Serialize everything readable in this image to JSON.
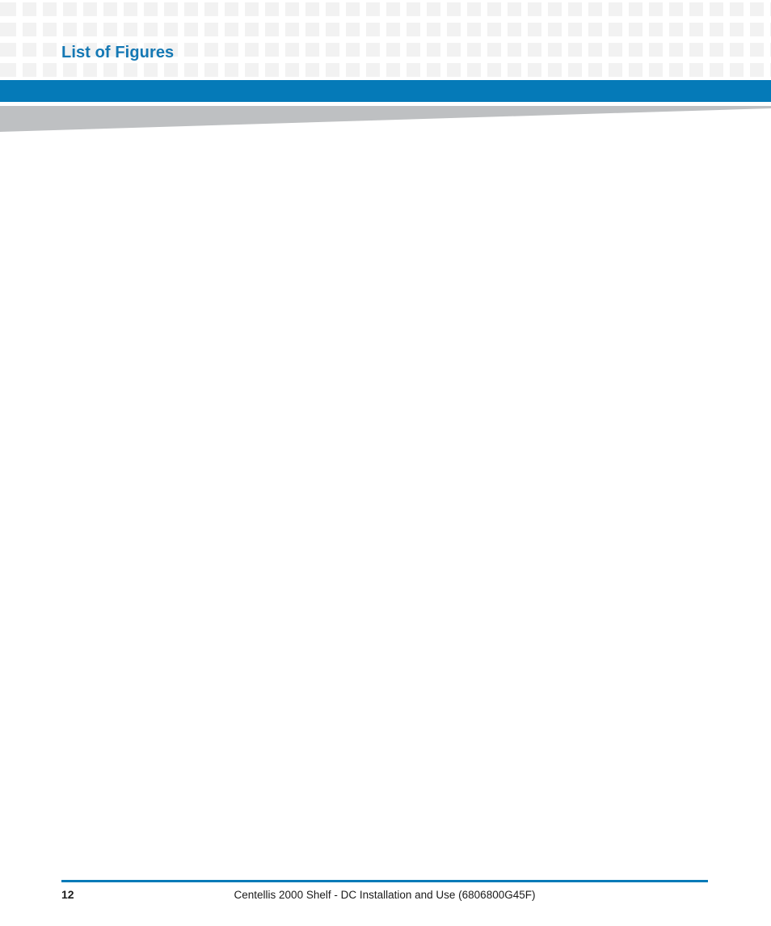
{
  "document": {
    "page_title": "List of Figures",
    "body_content": "",
    "accent_blue": "#057ab8",
    "title_blue": "#1478b4",
    "wedge_gray": "#bec0c2",
    "checker_square_color": "#f2f2f2"
  },
  "header": {
    "title": "List of Figures",
    "decoration": {
      "checker_pattern_name": "checker-squares-pattern",
      "blue_rule_name": "header-blue-rule",
      "wedge_name": "gray-taper-wedge"
    }
  },
  "footer": {
    "page_number": "12",
    "doc_title": "Centellis 2000 Shelf - DC Installation and Use (6806800G45F)"
  }
}
